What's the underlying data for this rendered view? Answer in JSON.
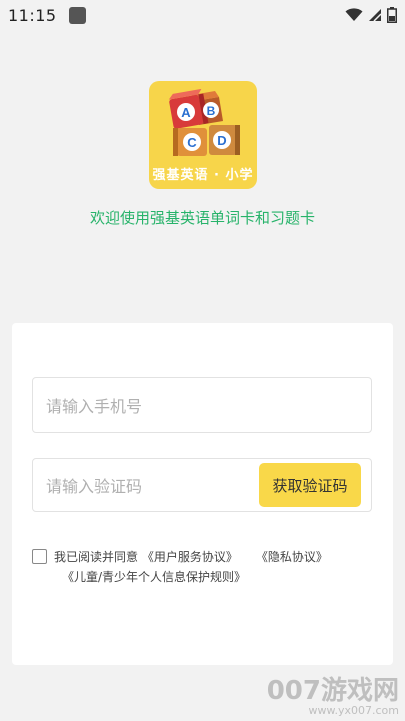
{
  "status_bar": {
    "time": "11:15",
    "icons": [
      "app-notification-icon",
      "wifi-icon",
      "signal-icon",
      "battery-icon"
    ]
  },
  "app_logo": {
    "brand_text": "强基英语 · 小学",
    "blocks": [
      "A",
      "B",
      "C",
      "D"
    ],
    "background_color": "#f7d54a"
  },
  "welcome_text": "欢迎使用强基英语单词卡和习题卡",
  "login_form": {
    "phone_placeholder": "请输入手机号",
    "code_placeholder": "请输入验证码",
    "get_code_button": "获取验证码",
    "agreement": {
      "prefix": "我已阅读并同意",
      "user_service": "《用户服务协议》",
      "privacy": "《隐私协议》",
      "child_privacy": "《儿童/青少年个人信息保护规则》",
      "checked": false
    }
  },
  "watermark": {
    "main": "007游戏网",
    "url": "www.yx007.com"
  },
  "colors": {
    "accent_green": "#27b36a",
    "button_yellow": "#f9d849",
    "background": "#f2f2f2"
  }
}
